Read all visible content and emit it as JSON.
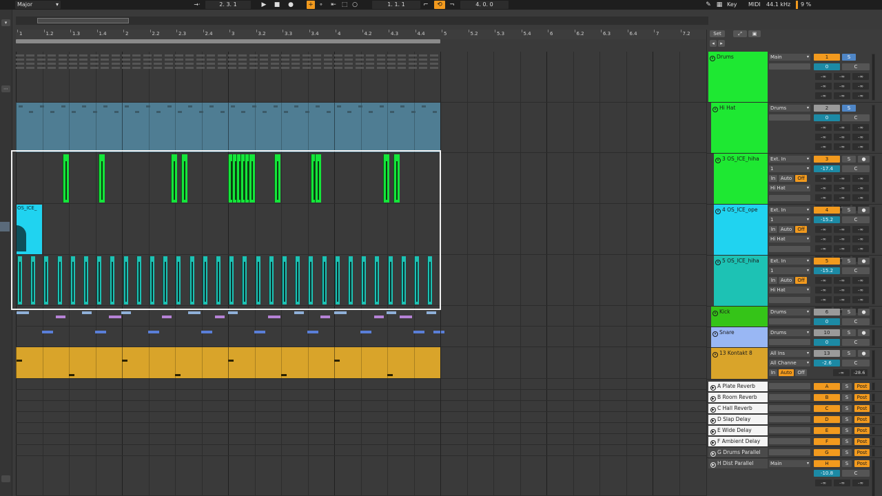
{
  "topbar": {
    "scale": "Major",
    "position": "2.   3.   1",
    "loop_start": "1.   1.   1",
    "loop_length": "4.   0.   0",
    "key_label": "Key",
    "midi_label": "MIDI",
    "sample_rate": "44.1 kHz",
    "cpu": "9 %"
  },
  "ruler": {
    "labels": [
      "1",
      "1.2",
      "1.3",
      "1.4",
      "2",
      "2.2",
      "2.3",
      "2.4",
      "3",
      "3.2",
      "3.3",
      "3.4",
      "4",
      "4.2",
      "4.3",
      "4.4",
      "5",
      "5.2",
      "5.3",
      "5.4",
      "6",
      "6.2",
      "6.3",
      "6.4",
      "7",
      "7.2"
    ]
  },
  "panel": {
    "set_label": "Set"
  },
  "clips": {
    "ice_clip_label": "OS_ICE_"
  },
  "tracks": [
    {
      "name": "Drums",
      "io": "Main",
      "num": "1",
      "solo": "S",
      "vol": "0",
      "pan": "C",
      "mini": [
        "-∞",
        "-∞",
        "-∞",
        "-∞",
        "-∞",
        "-∞",
        "-∞",
        "-∞",
        "-∞"
      ],
      "color": "#1ee832"
    },
    {
      "name": "Hi Hat",
      "io": "Drums",
      "num": "2",
      "solo": "S",
      "vol": "0",
      "pan": "C",
      "mini": [
        "-∞",
        "-∞",
        "-∞",
        "-∞",
        "-∞",
        "-∞",
        "-∞",
        "-∞",
        "-∞"
      ],
      "color": "#1ee832"
    },
    {
      "name": "3 OS_ICE_hiha",
      "io": "Ext. In",
      "io2": "1",
      "io3": "Hi Hat",
      "num": "3",
      "solo": "S",
      "vol": "-17.4",
      "pan": "C",
      "mon": [
        "In",
        "Auto",
        "Off"
      ],
      "mini": [
        "-∞",
        "-∞",
        "-∞",
        "-∞",
        "-∞",
        "-∞",
        "-∞",
        "-∞",
        "-∞",
        "-∞",
        "-∞",
        "-∞"
      ],
      "color": "#1ee832"
    },
    {
      "name": "4 OS_ICE_ope",
      "io": "Ext. In",
      "io2": "1",
      "io3": "Hi Hat",
      "num": "4",
      "solo": "S",
      "vol": "-15.2",
      "pan": "C",
      "mon": [
        "In",
        "Auto",
        "Off"
      ],
      "mini": [
        "-∞",
        "-∞",
        "-∞",
        "-∞",
        "-∞",
        "-∞",
        "-∞",
        "-∞",
        "-∞",
        "-∞",
        "-∞",
        "-∞"
      ],
      "color": "#20d3f0"
    },
    {
      "name": "5 OS_ICE_hiha",
      "io": "Ext. In",
      "io2": "1",
      "io3": "Hi Hat",
      "num": "5",
      "solo": "S",
      "vol": "-15.2",
      "pan": "C",
      "mon": [
        "In",
        "Auto",
        "Off"
      ],
      "mini": [
        "-∞",
        "-∞",
        "-∞",
        "-∞",
        "-∞",
        "-∞",
        "-∞",
        "-∞",
        "-∞",
        "-∞",
        "-∞",
        "-∞"
      ],
      "color": "#1dc2b4"
    },
    {
      "name": "Kick",
      "io": "Drums",
      "num": "6",
      "solo": "S",
      "vol": "0",
      "pan": "C",
      "color": "#35c418"
    },
    {
      "name": "Snare",
      "io": "Drums",
      "num": "10",
      "solo": "S",
      "vol": "0",
      "pan": "C",
      "color": "#99b7f4"
    },
    {
      "name": "13 Kontakt 8",
      "io": "All Ins",
      "io2": "All Channe",
      "num": "13",
      "solo": "S",
      "vol": "-2.6",
      "pan": "C",
      "mon": [
        "In",
        "Auto",
        "Off"
      ],
      "mini": [
        "-∞",
        "-28.6"
      ],
      "color": "#d9a42a"
    }
  ],
  "returns": [
    {
      "name": "A Plate Reverb",
      "num": "A",
      "solo": "S",
      "post": "Post"
    },
    {
      "name": "B Room Reverb",
      "num": "B",
      "solo": "S",
      "post": "Post"
    },
    {
      "name": "C Hall Reverb",
      "num": "C",
      "solo": "S",
      "post": "Post"
    },
    {
      "name": "D Slap Delay",
      "num": "D",
      "solo": "S",
      "post": "Post"
    },
    {
      "name": "E Wide Delay",
      "num": "E",
      "solo": "S",
      "post": "Post"
    },
    {
      "name": "F Ambient Delay",
      "num": "F",
      "solo": "S",
      "post": "Post"
    },
    {
      "name": "G Drums Parallel",
      "num": "G",
      "solo": "S",
      "post": "Post"
    },
    {
      "name": "H Dist Parallel",
      "io": "Main",
      "num": "H",
      "solo": "S",
      "post": "Post",
      "vol": "-10.8",
      "pan": "C",
      "mini": [
        "-∞",
        "-∞",
        "-∞"
      ]
    }
  ],
  "colors": {
    "accent": "#f29a1e",
    "selection": "#ffffff"
  },
  "icons": [
    "key-map-icon",
    "pencil-icon",
    "play-icon",
    "stop-icon",
    "record-icon",
    "loop-icon",
    "metronome-icon"
  ]
}
